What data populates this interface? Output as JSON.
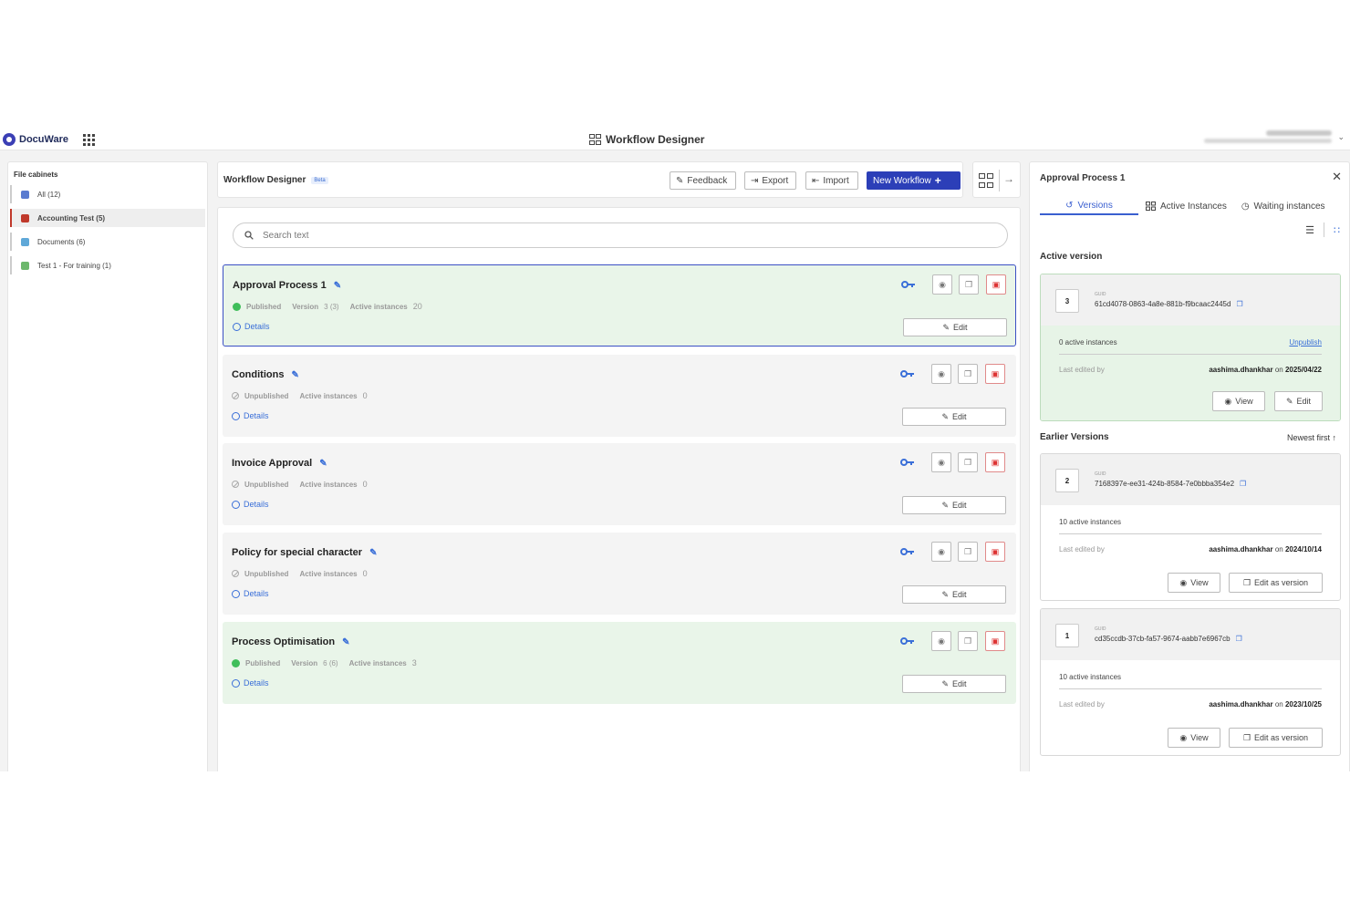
{
  "topbar": {
    "brand": "DocuWare",
    "app_title": "Workflow Designer"
  },
  "sidebar": {
    "title": "File cabinets",
    "items": [
      {
        "label": "All (12)",
        "color": "#5a7bd0"
      },
      {
        "label": "Accounting Test (5)",
        "color": "#c0392b"
      },
      {
        "label": "Documents (6)",
        "color": "#5fa8d8"
      },
      {
        "label": "Test 1 - For training (1)",
        "color": "#6cb86c"
      }
    ]
  },
  "header": {
    "title": "Workflow Designer",
    "beta": "Beta",
    "feedback": "Feedback",
    "export": "Export",
    "import": "Import",
    "new_workflow": "New Workflow"
  },
  "search": {
    "placeholder": "Search text"
  },
  "workflows": [
    {
      "name": "Approval Process 1",
      "status": "Published",
      "version_label": "Version",
      "version": "3 (3)",
      "instances_label": "Active instances",
      "instances": "20",
      "details": "Details",
      "edit": "Edit"
    },
    {
      "name": "Conditions",
      "status": "Unpublished",
      "instances_label": "Active instances",
      "instances": "0",
      "details": "Details",
      "edit": "Edit"
    },
    {
      "name": "Invoice Approval",
      "status": "Unpublished",
      "instances_label": "Active instances",
      "instances": "0",
      "details": "Details",
      "edit": "Edit"
    },
    {
      "name": "Policy for special character",
      "status": "Unpublished",
      "instances_label": "Active instances",
      "instances": "0",
      "details": "Details",
      "edit": "Edit"
    },
    {
      "name": "Process Optimisation",
      "status": "Published",
      "version_label": "Version",
      "version": "6 (6)",
      "instances_label": "Active instances",
      "instances": "3",
      "details": "Details",
      "edit": "Edit"
    }
  ],
  "panel": {
    "title": "Approval Process 1",
    "tabs": [
      "Versions",
      "Active Instances",
      "Waiting instances"
    ],
    "active_version_label": "Active version",
    "earlier_label": "Earlier Versions",
    "sort_label": "Newest first",
    "guid_label": "GUID",
    "last_edited_label": "Last edited by",
    "on_label": "on",
    "versions": [
      {
        "num": "3",
        "guid": "61cd4078-0863-4a8e-881b-f9bcaac2445d",
        "instances": "0 active instances",
        "unpublish": "Unpublish",
        "user": "aashima.dhankhar",
        "date": "2025/04/22",
        "view": "View",
        "edit": "Edit"
      },
      {
        "num": "2",
        "guid": "7168397e-ee31-424b-8584-7e0bbba354e2",
        "instances": "10 active instances",
        "user": "aashima.dhankhar",
        "date": "2024/10/14",
        "view": "View",
        "edit": "Edit as version"
      },
      {
        "num": "1",
        "guid": "cd35ccdb-37cb-fa57-9674-aabb7e6967cb",
        "instances": "10 active instances",
        "user": "aashima.dhankhar",
        "date": "2023/10/25",
        "view": "View",
        "edit": "Edit as version"
      }
    ]
  }
}
